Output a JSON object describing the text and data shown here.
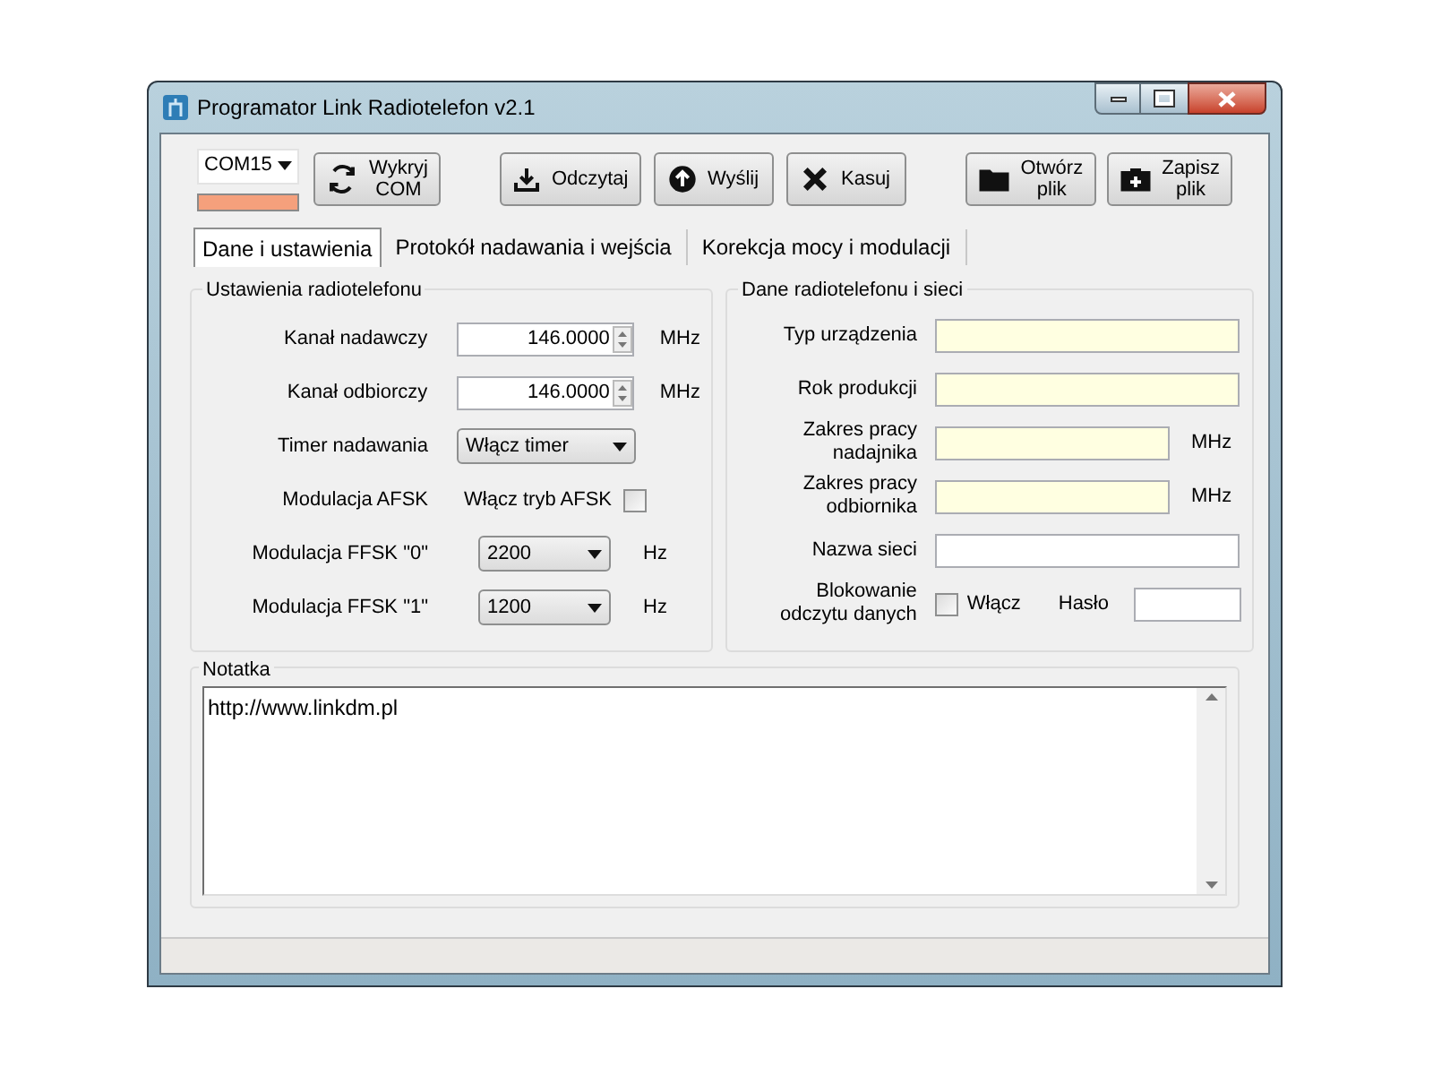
{
  "window": {
    "title": "Programator Link Radiotelefon v2.1"
  },
  "port": {
    "value": "COM15"
  },
  "toolbar_groups": [
    [
      {
        "label": "Wykryj\nCOM"
      }
    ],
    [
      {
        "label": "Odczytaj"
      },
      {
        "label": "Wyślij"
      },
      {
        "label": "Kasuj"
      }
    ],
    [
      {
        "label": "Otwórz\nplik"
      },
      {
        "label": "Zapisz\nplik"
      }
    ]
  ],
  "tabs": [
    {
      "label": "Dane i ustawienia",
      "selected": true
    },
    {
      "label": "Protokół nadawania i wejścia",
      "selected": false
    },
    {
      "label": "Korekcja mocy i modulacji",
      "selected": false
    }
  ],
  "settings": {
    "title": "Ustawienia radiotelefonu",
    "rows": [
      {
        "kind": "spin",
        "label": "Kanał nadawczy",
        "value": "146.0000",
        "unit": "MHz"
      },
      {
        "kind": "spin",
        "label": "Kanał odbiorczy",
        "value": "146.0000",
        "unit": "MHz"
      },
      {
        "kind": "select",
        "label": "Timer nadawania",
        "value": "Włącz timer"
      },
      {
        "kind": "check",
        "label": "Modulacja AFSK",
        "text": "Włącz tryb AFSK",
        "checked": false
      },
      {
        "kind": "select_short",
        "label": "Modulacja FFSK \"0\"",
        "value": "2200",
        "unit": "Hz"
      },
      {
        "kind": "select_short",
        "label": "Modulacja FFSK \"1\"",
        "value": "1200",
        "unit": "Hz"
      }
    ]
  },
  "device": {
    "title": "Dane radiotelefonu i sieci",
    "rows": [
      {
        "kind": "text",
        "label": "Typ urządzenia",
        "highlighted": true
      },
      {
        "kind": "text",
        "label": "Rok produkcji",
        "highlighted": true
      },
      {
        "kind": "text_unit",
        "label": "Zakres pracy\nnadajnika",
        "unit": "MHz",
        "highlighted": true
      },
      {
        "kind": "text_unit",
        "label": "Zakres pracy\nodbiornika",
        "unit": "MHz",
        "highlighted": true
      },
      {
        "kind": "text",
        "label": "Nazwa sieci",
        "highlighted": false
      },
      {
        "kind": "lock",
        "label": "Blokowanie\nodczytu danych",
        "text": "Włącz",
        "checked": false,
        "password_label": "Hasło"
      }
    ]
  },
  "note": {
    "title": "Notatka",
    "value": "http://www.linkdm.pl"
  }
}
